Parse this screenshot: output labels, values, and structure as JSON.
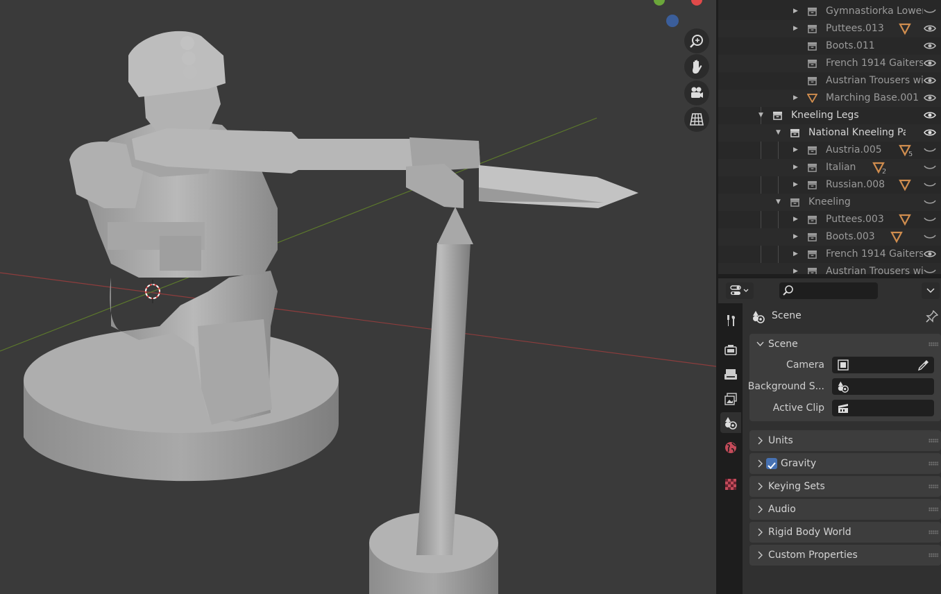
{
  "viewport": {
    "nav_buttons": [
      "zoom-icon",
      "hand-pan-icon",
      "camera-view-icon",
      "ortho-grid-icon"
    ]
  },
  "outliner": {
    "rows": [
      {
        "label": "Gymnastiorka Lower.(",
        "icon": "collection-icon",
        "expandable": true
      },
      {
        "label": "Puttees.013",
        "icon": "collection-icon",
        "expandable": true,
        "tag": "mesh-data-icon"
      },
      {
        "label": "Boots.011",
        "icon": "collection-icon",
        "expandable": false
      },
      {
        "label": "French 1914 Gaiters (",
        "icon": "collection-icon",
        "expandable": false
      },
      {
        "label": "Austrian Trousers witl",
        "icon": "collection-icon",
        "expandable": false
      },
      {
        "label": "Marching Base.001",
        "icon": "mesh-icon",
        "expandable": true
      },
      {
        "label": "Kneeling Legs",
        "icon": "collection-icon",
        "expanded": true
      },
      {
        "label": "National Kneeling Parts",
        "icon": "collection-icon",
        "expanded": true
      },
      {
        "label": "Austria.005",
        "icon": "collection-icon",
        "expandable": true,
        "tag": "mesh-data-icon",
        "count": "5"
      },
      {
        "label": "Italian",
        "icon": "collection-icon",
        "expandable": true,
        "tag": "mesh-data-icon",
        "count": "2"
      },
      {
        "label": "Russian.008",
        "icon": "collection-icon",
        "expandable": true,
        "tag": "mesh-data-icon"
      },
      {
        "label": "Kneeling",
        "icon": "collection-icon",
        "expanded": true
      },
      {
        "label": "Puttees.003",
        "icon": "collection-icon",
        "expandable": true,
        "tag": "mesh-data-icon"
      },
      {
        "label": "Boots.003",
        "icon": "collection-icon",
        "expandable": true,
        "tag": "mesh-data-icon"
      },
      {
        "label": "French 1914 Gaiters (",
        "icon": "collection-icon",
        "expandable": true
      },
      {
        "label": "Austrian Trousers witl",
        "icon": "collection-icon",
        "expandable": true
      }
    ]
  },
  "properties": {
    "search": {
      "placeholder": ""
    },
    "context_label": "Scene",
    "scene_panel": {
      "title": "Scene",
      "camera_label": "Camera",
      "background_label": "Background S...",
      "active_clip_label": "Active Clip"
    },
    "panels": [
      {
        "title": "Units"
      },
      {
        "title": "Gravity",
        "checkbox": true,
        "checked": true
      },
      {
        "title": "Keying Sets"
      },
      {
        "title": "Audio"
      },
      {
        "title": "Rigid Body World"
      },
      {
        "title": "Custom Properties"
      }
    ],
    "tabs": [
      "tool-icon",
      "render-icon",
      "output-icon",
      "view-layer-icon",
      "scene-icon",
      "world-icon",
      "texture-icon"
    ],
    "active_tab": "scene-icon"
  },
  "colors": {
    "accent_blue": "#4772b3",
    "mesh_tag": "#d08d4e",
    "x_axis": "#a83c3c",
    "y_axis": "#6b8a2e"
  }
}
